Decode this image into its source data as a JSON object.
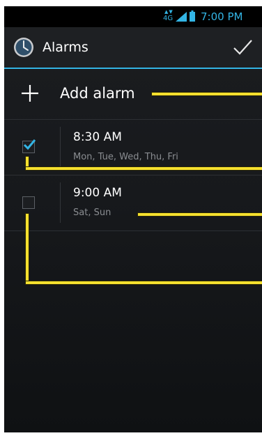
{
  "status_bar": {
    "network_type": "4G",
    "network_arrows": "▲▼",
    "time": "7:00 PM",
    "icons": [
      "network-4g-icon",
      "signal-icon",
      "battery-icon"
    ]
  },
  "action_bar": {
    "title": "Alarms",
    "app_icon": "clock-icon",
    "done_icon": "checkmark-icon"
  },
  "add_alarm": {
    "icon": "plus-icon",
    "label": "Add alarm"
  },
  "alarms": [
    {
      "time": "8:30 AM",
      "days": "Mon, Tue, Wed, Thu, Fri",
      "enabled": true
    },
    {
      "time": "9:00 AM",
      "days": "Sat, Sun",
      "enabled": false
    }
  ],
  "colors": {
    "accent": "#33b5e5",
    "background": "#17191c",
    "callout": "#f5e02e"
  }
}
